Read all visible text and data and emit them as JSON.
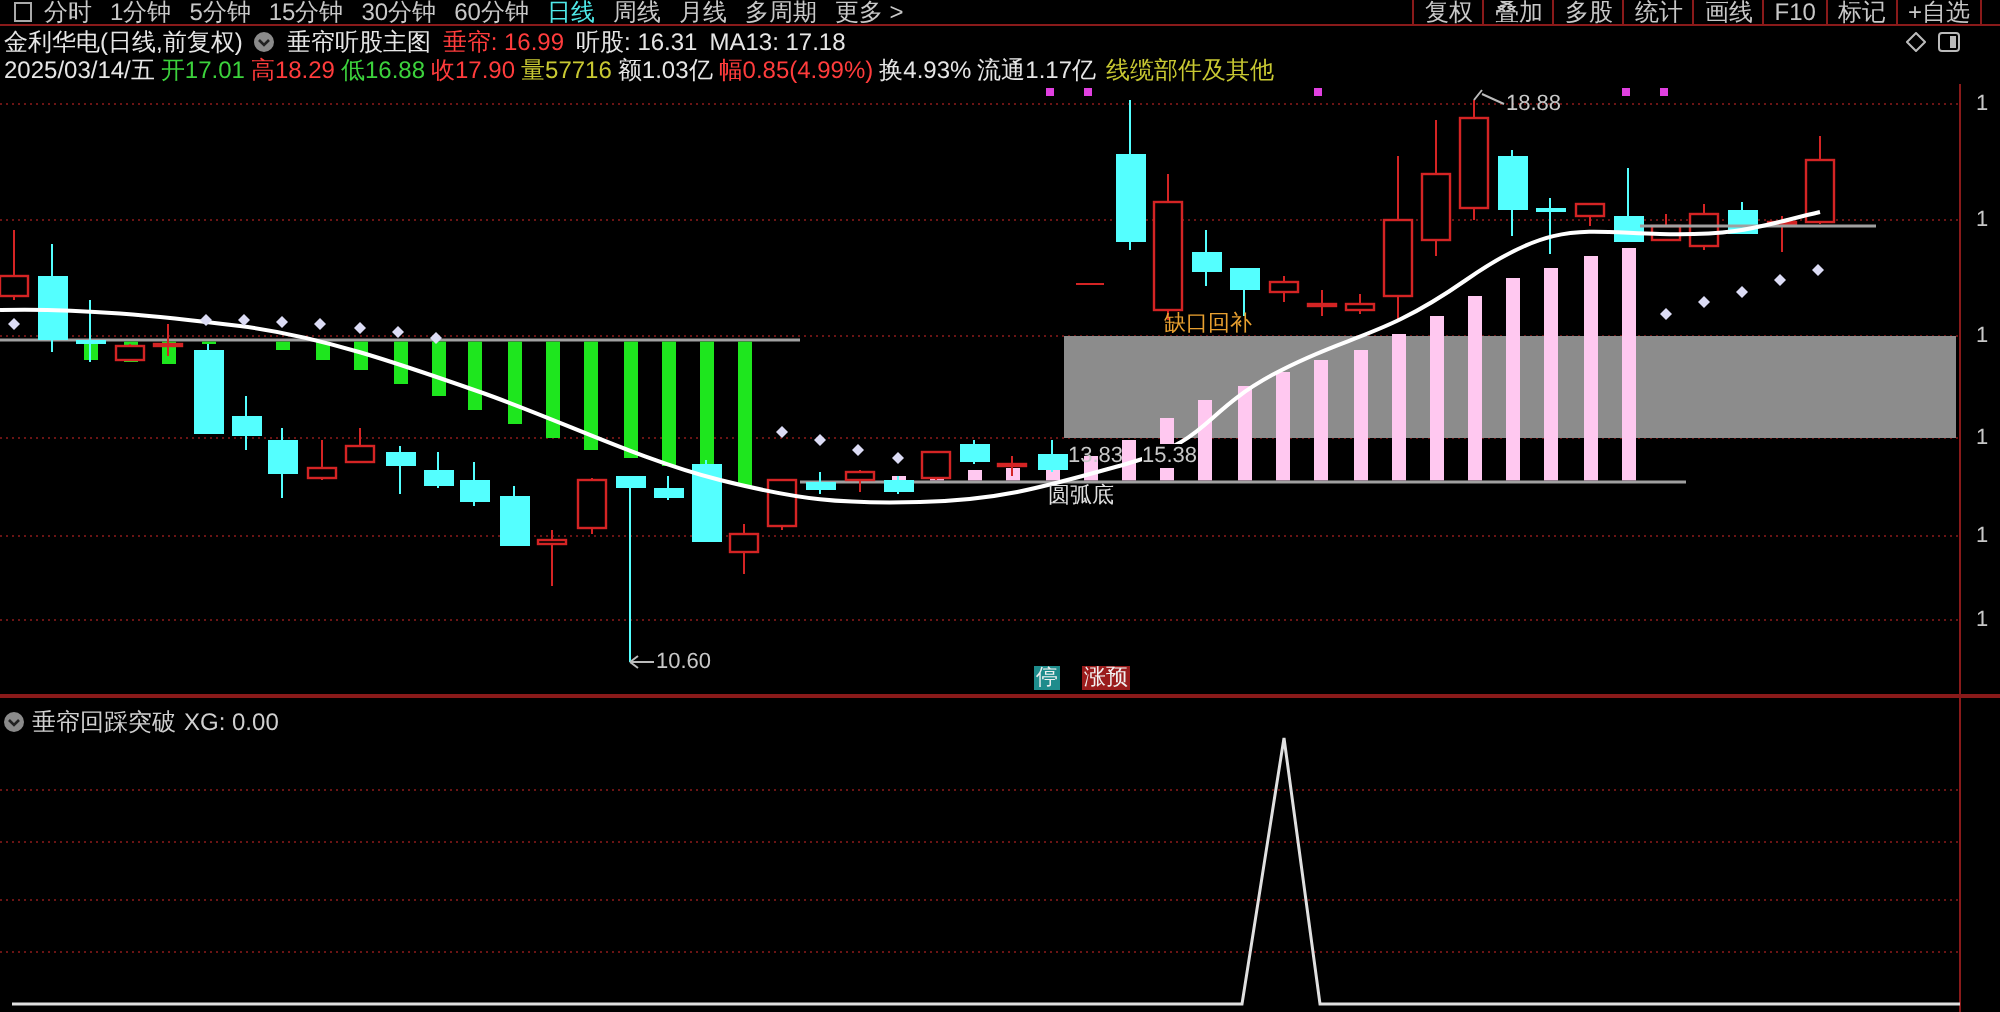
{
  "toolbar": {
    "periods": [
      {
        "label": "分时",
        "selected": false
      },
      {
        "label": "1分钟",
        "selected": false
      },
      {
        "label": "5分钟",
        "selected": false
      },
      {
        "label": "15分钟",
        "selected": false
      },
      {
        "label": "30分钟",
        "selected": false
      },
      {
        "label": "60分钟",
        "selected": false
      },
      {
        "label": "日线",
        "selected": true
      },
      {
        "label": "周线",
        "selected": false
      },
      {
        "label": "月线",
        "selected": false
      },
      {
        "label": "多周期",
        "selected": false
      },
      {
        "label": "更多 >",
        "selected": false
      }
    ],
    "tools": [
      "复权",
      "叠加",
      "多股",
      "统计",
      "画线",
      "F10",
      "标记",
      "+自选"
    ]
  },
  "header": {
    "title": "金利华电(日线,前复权)",
    "indicator": "垂帘听股主图",
    "quotes": [
      {
        "label": "垂帘:",
        "value": "16.99",
        "color": "#ff3c3c"
      },
      {
        "label": "听股:",
        "value": "16.31",
        "color": "#e6e6e6"
      },
      {
        "label": "MA13:",
        "value": "17.18",
        "color": "#e6e6e6"
      }
    ]
  },
  "info": {
    "date": "2025/03/14/五",
    "items": [
      {
        "label": "开",
        "value": "17.01",
        "color": "#3cd23c"
      },
      {
        "label": "高",
        "value": "18.29",
        "color": "#ff3c3c"
      },
      {
        "label": "低",
        "value": "16.88",
        "color": "#3cd23c"
      },
      {
        "label": "收",
        "value": "17.90",
        "color": "#ff3c3c"
      },
      {
        "label": "量",
        "value": "57716",
        "color": "#c8c832"
      },
      {
        "label": "额",
        "value": "1.03亿",
        "color": "#e6e6e6"
      },
      {
        "label": "幅",
        "value": "0.85(4.99%)",
        "color": "#ff3c3c"
      },
      {
        "label": "换",
        "value": "4.93%",
        "color": "#e6e6e6"
      },
      {
        "label": "流通",
        "value": "1.17亿",
        "color": "#e6e6e6"
      }
    ],
    "sector": "线缆部件及其他"
  },
  "chart": {
    "high_label": "18.88",
    "low_label": "10.60",
    "level_labels": [
      "13.83",
      "15.38"
    ],
    "gap_signal": "缺口回补",
    "pattern_signal": "圆弧底",
    "badges": [
      {
        "text": "停",
        "color": "#1e8c8c"
      },
      {
        "text": "涨预",
        "color": "#9a1c1c"
      }
    ],
    "axis_labels": [
      "1",
      "1",
      "1",
      "1",
      "1",
      "1"
    ]
  },
  "indicator": {
    "title": "垂帘回踩突破",
    "reading": "XG: 0.00"
  }
}
